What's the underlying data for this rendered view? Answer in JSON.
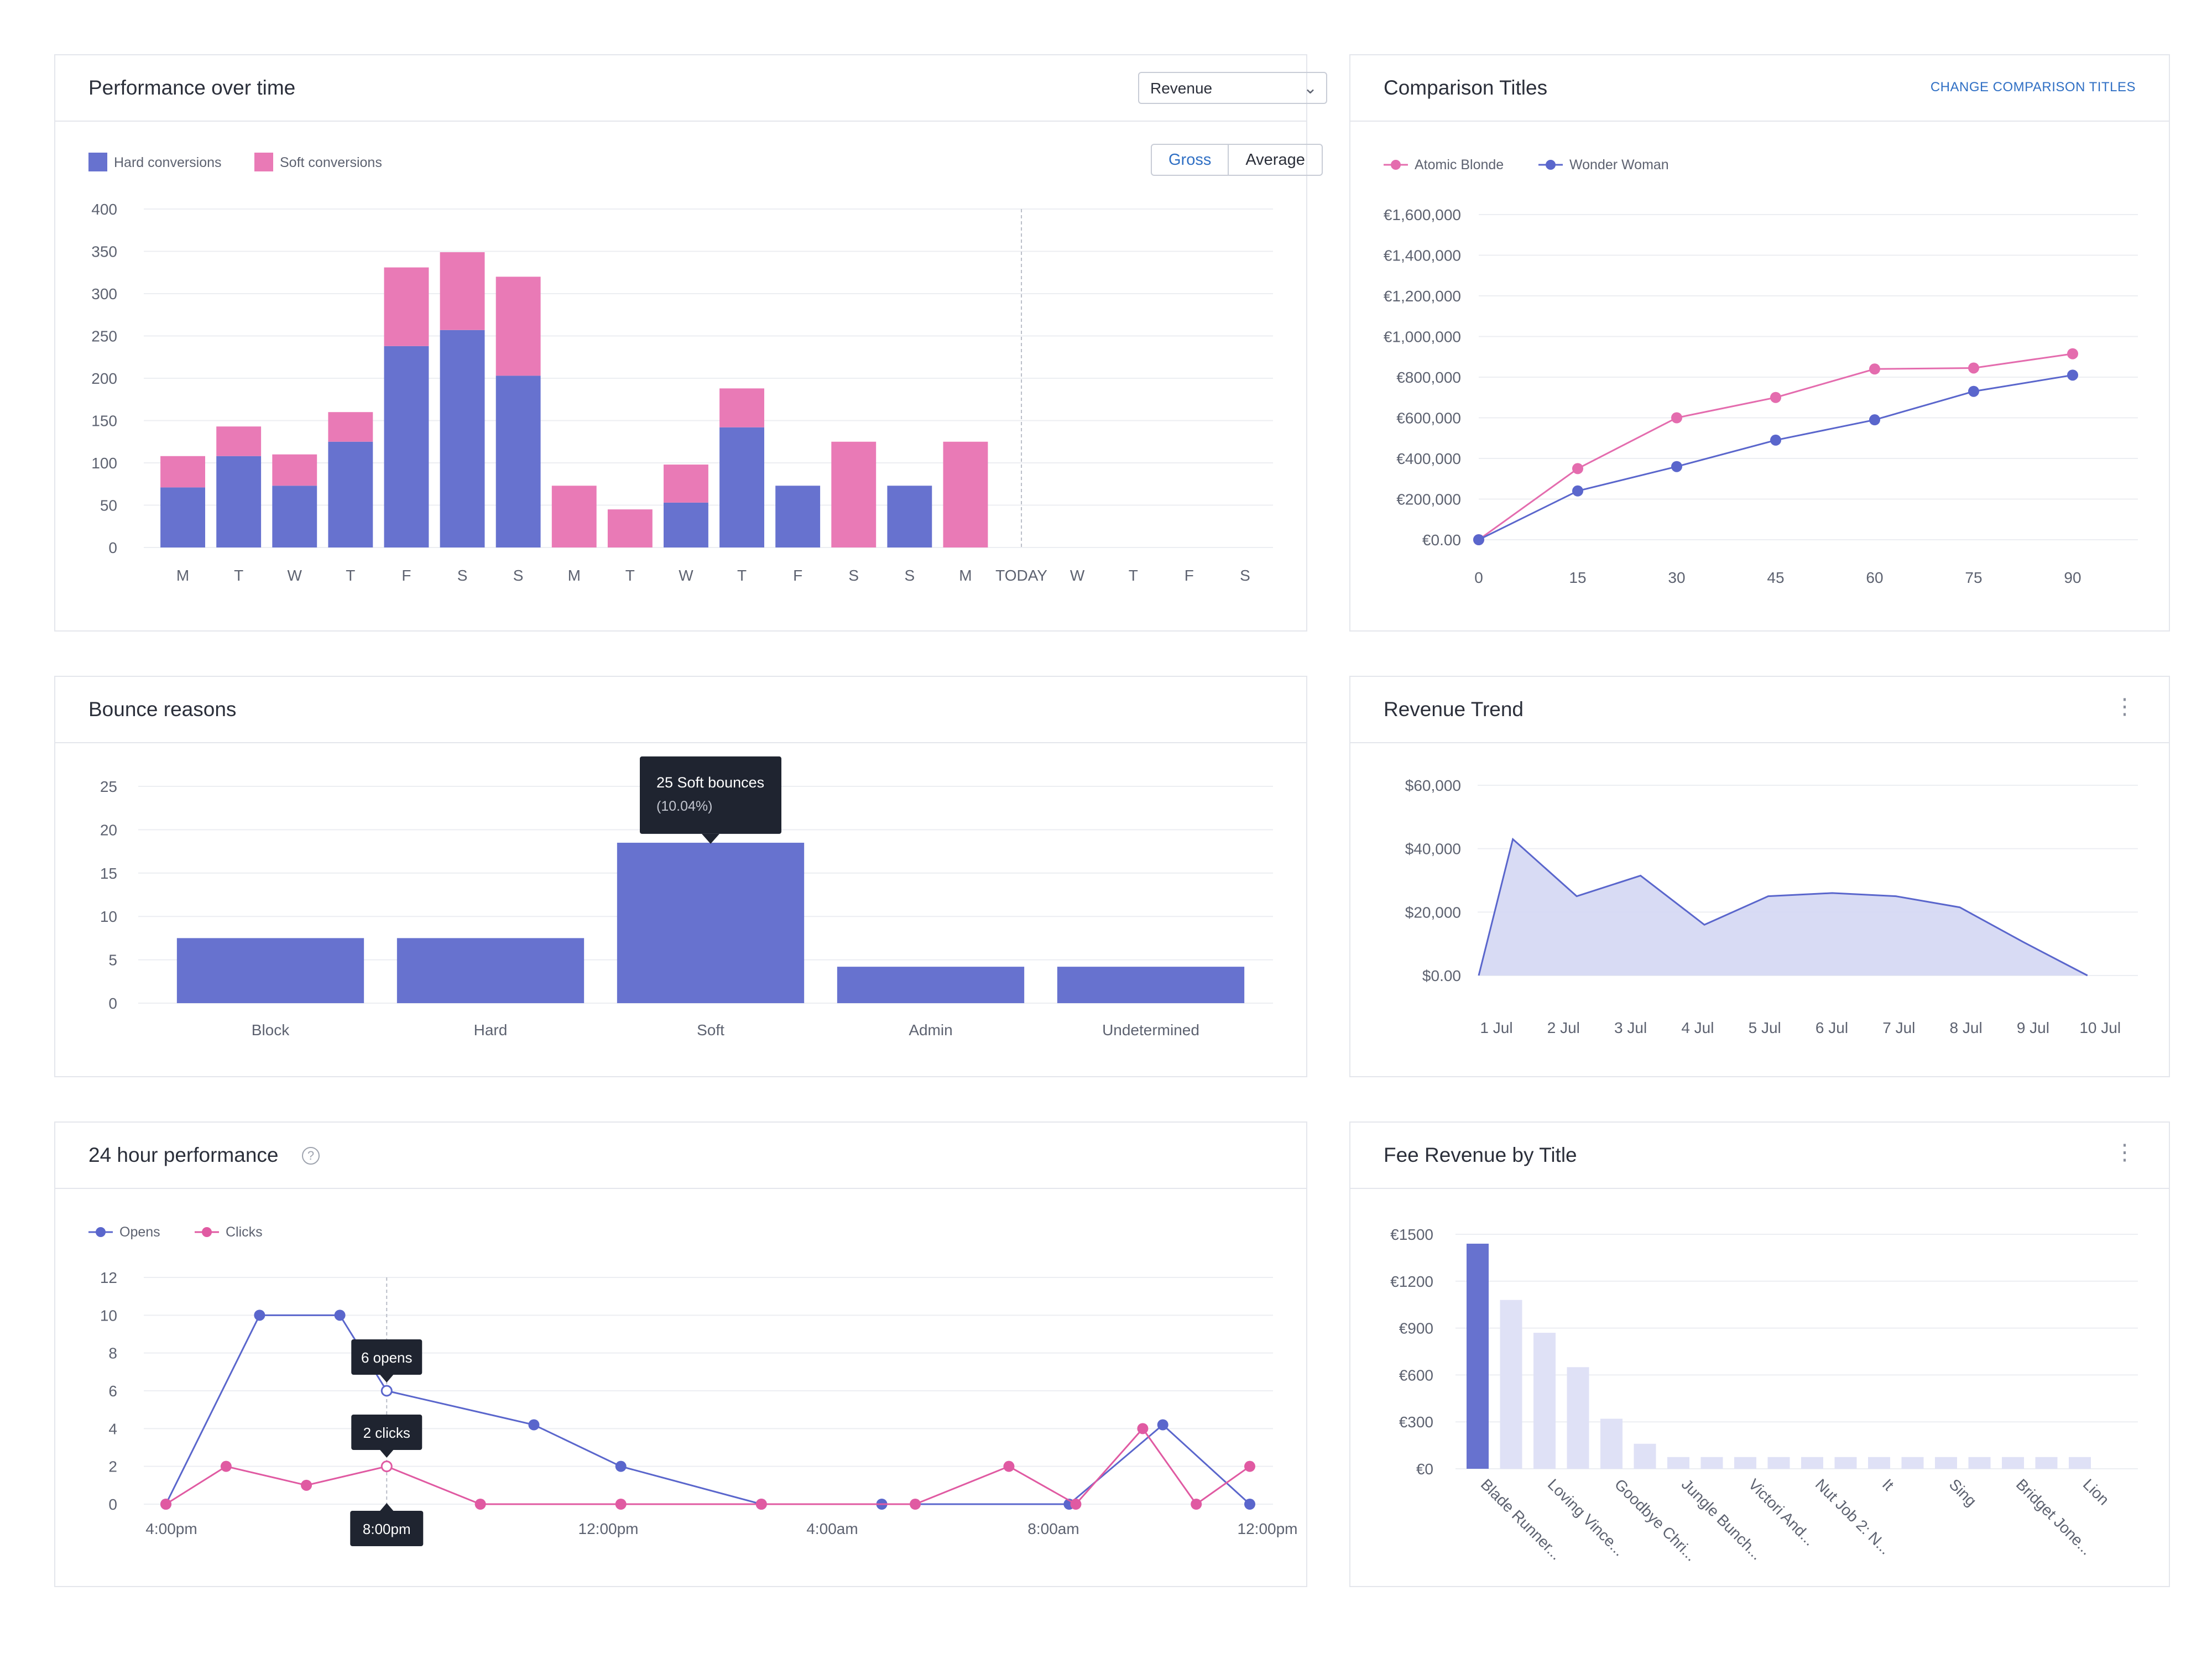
{
  "cards": {
    "performance": {
      "title": "Performance over time",
      "metric_select": "Revenue",
      "toggle": {
        "gross": "Gross",
        "average": "Average"
      }
    },
    "comparison": {
      "title": "Comparison Titles",
      "change_link": "CHANGE COMPARISON TITLES"
    },
    "bounce": {
      "title": "Bounce reasons"
    },
    "revenue_trend": {
      "title": "Revenue Trend",
      "menu": "⋮"
    },
    "hour24": {
      "title": "24 hour performance",
      "help": "?"
    },
    "fee": {
      "title": "Fee Revenue by Title",
      "menu": "⋮"
    }
  },
  "chart_data": [
    {
      "id": "performance",
      "type": "bar",
      "stacked": true,
      "title": "Performance over time",
      "categories": [
        "M",
        "T",
        "W",
        "T",
        "F",
        "S",
        "S",
        "M",
        "T",
        "W",
        "T",
        "F",
        "S",
        "S",
        "M",
        "TODAY",
        "W",
        "T",
        "F",
        "S"
      ],
      "series": [
        {
          "name": "Hard conversions",
          "color": "#6772cf",
          "values": [
            71,
            108,
            73,
            125,
            238,
            257,
            203,
            0,
            0,
            53,
            142,
            73,
            0,
            73,
            0,
            null,
            null,
            null,
            null,
            null
          ]
        },
        {
          "name": "Soft conversions",
          "color": "#e97ab6",
          "values": [
            37,
            35,
            37,
            35,
            93,
            92,
            117,
            73,
            45,
            45,
            46,
            0,
            125,
            0,
            125,
            null,
            null,
            null,
            null,
            null
          ]
        }
      ],
      "ylim": [
        0,
        400
      ],
      "yticks": [
        0,
        50,
        100,
        150,
        200,
        250,
        300,
        350,
        400
      ],
      "marker_category": "TODAY",
      "grid": true,
      "legend": "top-left"
    },
    {
      "id": "comparison",
      "type": "line",
      "title": "Comparison Titles",
      "x": [
        0,
        15,
        30,
        45,
        60,
        75,
        90
      ],
      "series": [
        {
          "name": "Atomic Blonde",
          "color": "#e46cae",
          "values": [
            0,
            350000,
            600000,
            700000,
            840000,
            845000,
            915000
          ]
        },
        {
          "name": "Wonder Woman",
          "color": "#5a66cc",
          "values": [
            0,
            240000,
            360000,
            490000,
            590000,
            730000,
            810000
          ]
        }
      ],
      "ylim": [
        0,
        1600000
      ],
      "ytick_labels": [
        "€0.00",
        "€200,000",
        "€400,000",
        "€600,000",
        "€800,000",
        "€1,000,000",
        "€1,200,000",
        "€1,400,000",
        "€1,600,000"
      ],
      "grid": true,
      "legend": "top-left"
    },
    {
      "id": "bounce",
      "type": "bar",
      "title": "Bounce reasons",
      "categories": [
        "Block",
        "Hard",
        "Soft",
        "Admin",
        "Undetermined"
      ],
      "values": [
        7.5,
        7.5,
        18.5,
        4.2,
        4.2
      ],
      "ylim": [
        0,
        25
      ],
      "yticks": [
        0,
        5,
        10,
        15,
        20,
        25
      ],
      "highlight": {
        "category": "Soft",
        "tooltip_line1": "25 Soft bounces",
        "tooltip_line2": "(10.04%)"
      },
      "color": "#6772cf",
      "grid": true
    },
    {
      "id": "revenue_trend",
      "type": "area",
      "title": "Revenue Trend",
      "categories": [
        "1 Jul",
        "2 Jul",
        "3 Jul",
        "4 Jul",
        "5 Jul",
        "6 Jul",
        "7 Jul",
        "8 Jul",
        "9 Jul",
        "10 Jul"
      ],
      "values": [
        0,
        43000,
        25000,
        31500,
        16000,
        25000,
        26000,
        25000,
        21500,
        10500,
        0
      ],
      "ylim": [
        0,
        60000
      ],
      "ytick_labels": [
        "$0.00",
        "$20,000",
        "$40,000",
        "$60,000"
      ],
      "color": "#5a66cc",
      "fill": "#d4d7f3",
      "grid": true
    },
    {
      "id": "hour24",
      "type": "line",
      "title": "24 hour performance",
      "x_labels": [
        "4:00pm",
        "8:00pm",
        "12:00pm",
        "4:00am",
        "8:00am",
        "12:00pm"
      ],
      "series": [
        {
          "name": "Opens",
          "color": "#5a66cc",
          "points": [
            [
              0,
              0
            ],
            [
              1.4,
              10
            ],
            [
              2.6,
              10
            ],
            [
              3.3,
              6
            ],
            [
              5.5,
              4.2
            ],
            [
              6.8,
              2
            ],
            [
              8.9,
              0
            ],
            [
              10.7,
              0
            ],
            [
              13.5,
              0
            ],
            [
              14.9,
              4.2
            ],
            [
              16.2,
              0
            ]
          ]
        },
        {
          "name": "Clicks",
          "color": "#e05aa2",
          "points": [
            [
              0,
              0
            ],
            [
              0.9,
              2
            ],
            [
              2.1,
              1
            ],
            [
              3.3,
              2
            ],
            [
              4.7,
              0
            ],
            [
              6.8,
              0
            ],
            [
              8.9,
              0
            ],
            [
              11.2,
              0
            ],
            [
              12.6,
              2
            ],
            [
              13.6,
              0
            ],
            [
              14.6,
              4
            ],
            [
              15.4,
              0
            ],
            [
              16.2,
              2
            ]
          ]
        }
      ],
      "xlim": [
        0,
        17
      ],
      "ylim": [
        0,
        12
      ],
      "yticks": [
        0,
        2,
        4,
        6,
        8,
        10,
        12
      ],
      "hover": {
        "x": 3.3,
        "opens_label": "6 opens",
        "clicks_label": "2 clicks",
        "time_label": "8:00pm"
      },
      "grid": true,
      "legend": "top-left"
    },
    {
      "id": "fee",
      "type": "bar",
      "title": "Fee Revenue by Title",
      "categories": [
        "Blade Runner...",
        "",
        "Loving Vince...",
        "",
        "Goodbye Chri...",
        "",
        "Jungle Bunch...",
        "",
        "Victori And...",
        "",
        "Nut Job 2: N...",
        "",
        "It",
        "",
        "Sing",
        "",
        "Bridget Jone...",
        "",
        "Lion"
      ],
      "values": [
        1440,
        1080,
        870,
        650,
        320,
        160,
        75,
        75,
        75,
        75,
        75,
        75,
        75,
        75,
        75,
        75,
        75,
        75,
        75
      ],
      "ylim": [
        0,
        1500
      ],
      "ytick_labels": [
        "€0",
        "€300",
        "€600",
        "€900",
        "€1200",
        "€1500"
      ],
      "color": "#6772cf",
      "faded_color": "#dfe1f6",
      "highlight_index": 0,
      "grid": true
    }
  ]
}
